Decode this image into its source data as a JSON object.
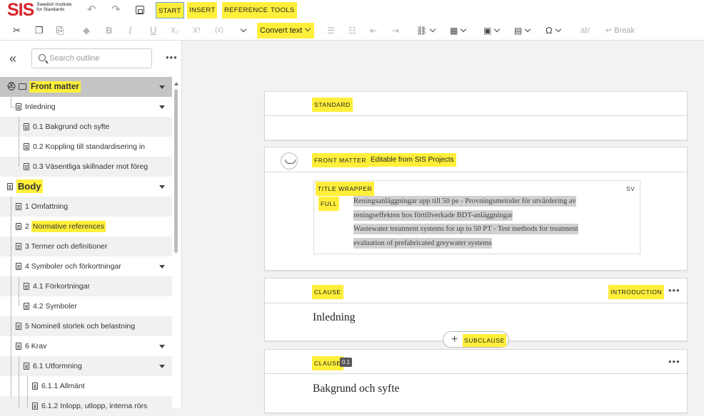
{
  "app": {
    "logo_mark": "SIS",
    "logo_text": "Swedish Institute for Standards"
  },
  "menu": {
    "tabs": [
      "START",
      "INSERT",
      "REFERENCE",
      "TOOLS"
    ],
    "active": "START"
  },
  "toolbar": {
    "convert_label": "Convert text",
    "subscript": "X₂",
    "superscript": "X¹",
    "variable": "(x)",
    "text_style": "ab'",
    "break_label": "Break",
    "icons": [
      "cut-icon",
      "copy-icon",
      "paste-icon",
      "eraser-icon",
      "bold-icon",
      "italic-icon",
      "underline-icon",
      "subscript-icon",
      "superscript-icon",
      "variable-icon",
      "bullet-list-icon",
      "numbered-list-icon",
      "outdent-icon",
      "indent-icon",
      "link-icon",
      "table-icon",
      "image-icon",
      "calculator-icon",
      "omega-icon",
      "break-icon"
    ]
  },
  "sidebar": {
    "search_placeholder": "Search outline",
    "items": [
      {
        "label": "Front matter"
      },
      {
        "label": "Inledning"
      },
      {
        "label": "0.1 Bakgrund och syfte"
      },
      {
        "label": "0.2 Koppling till standardisering in"
      },
      {
        "label": "0.3 Väsentliga skillnader mot föreg"
      },
      {
        "label": "Body"
      },
      {
        "label": "1 Omfattning"
      },
      {
        "label": "2 ",
        "highlight": "Normative references"
      },
      {
        "label": "3 Termer och definitioner"
      },
      {
        "label": "4 Symboler och förkortningar"
      },
      {
        "label": "4.1 Förkortningar"
      },
      {
        "label": "4.2 Symboler"
      },
      {
        "label": "5 Nominell storlek och belastning"
      },
      {
        "label": "6 Krav"
      },
      {
        "label": "6.1 Utformning"
      },
      {
        "label": "6.1.1 Allmänt"
      },
      {
        "label": "6.1.2 Inlopp, utlopp, interna rörs"
      }
    ]
  },
  "main": {
    "standard_tag": "STANDARD",
    "front_matter_tag": "FRONT MATTER",
    "editable_tag": "Editable from SIS Projects",
    "title_wrapper_tag": "TITLE WRAPPER",
    "full_tag": "FULL",
    "lang": "SV",
    "title_lines": [
      "Reningsanläggningar upp till 50 pe - Provningsmetoder för utvärdering av",
      "reningseffekten hos förtillverkade BDT-anläggningar",
      "Wastewater treatment systems for up to 50 PT - Test methods for treatment",
      "evaluation of prefabricated greywater systems"
    ],
    "clause1_tag": "CLAUSE",
    "clause1_type": "INTRODUCTION",
    "clause1_heading": "Inledning",
    "subclause_label": "SUBCLAUSE",
    "clause2_tag": "CLAUSE",
    "clause2_number": "0.1",
    "clause2_heading": "Bakgrund och syfte"
  }
}
